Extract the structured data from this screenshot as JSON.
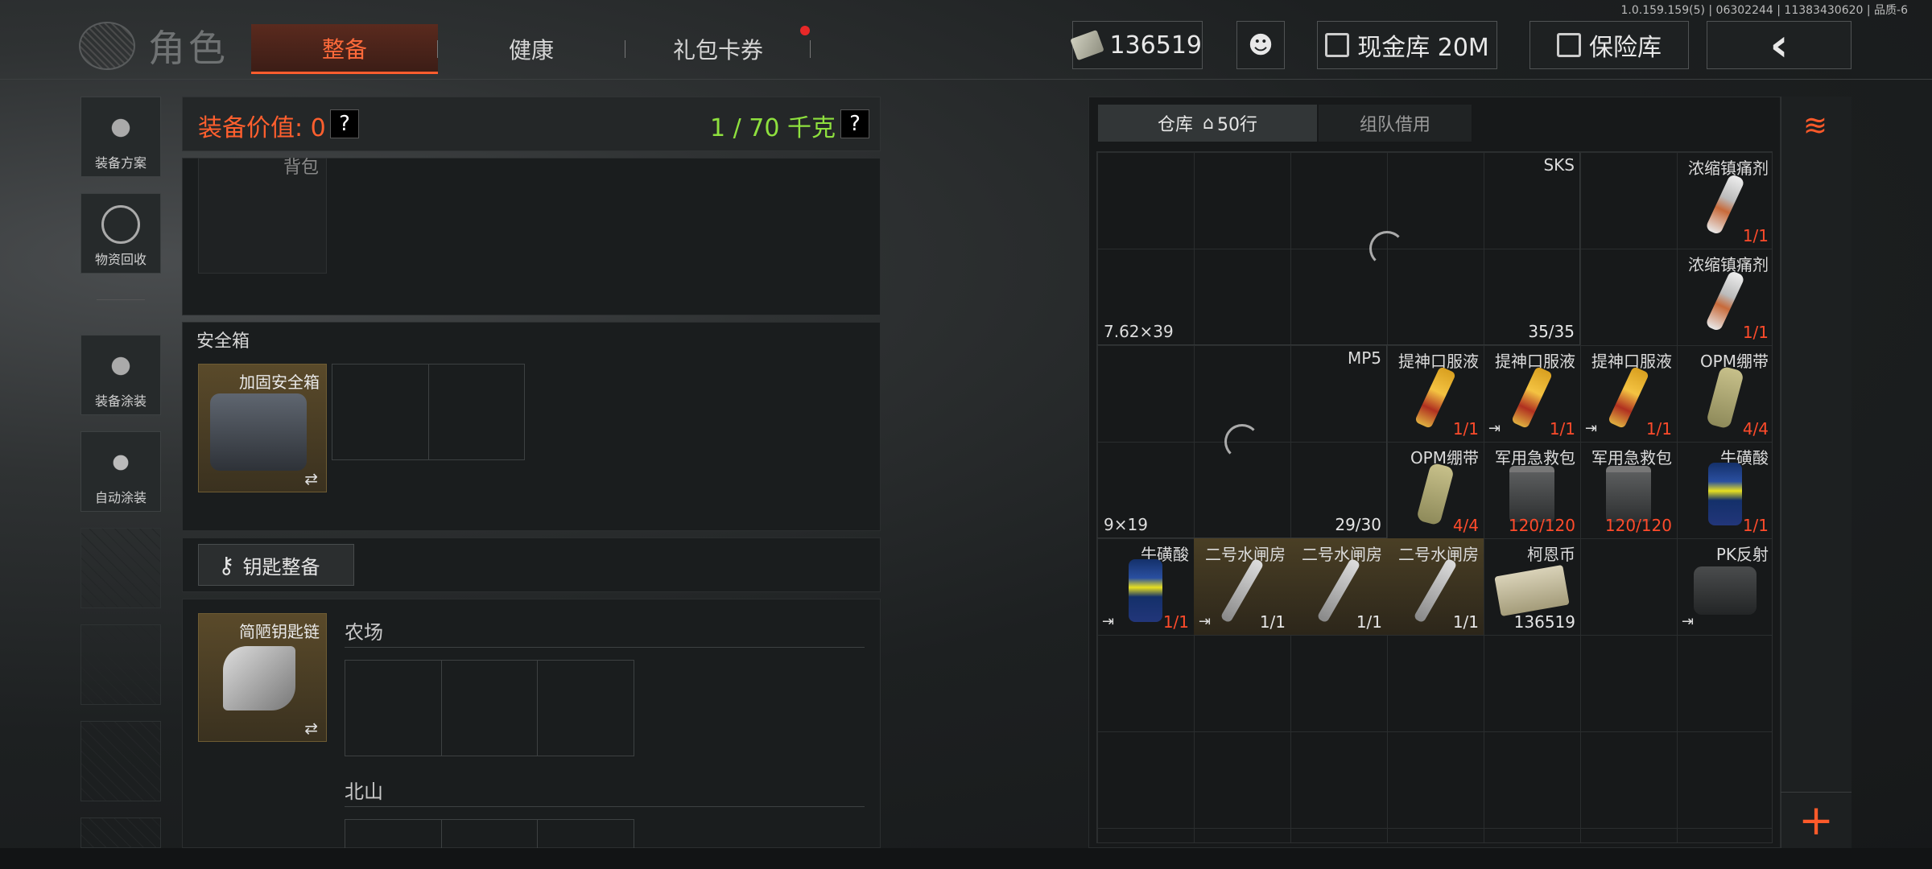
{
  "version": "1.0.159.159(5) | 06302244 | 11383430620 | 品质-6",
  "header": {
    "logo_title": "角色",
    "tabs": [
      {
        "label": "整备"
      },
      {
        "label": "健康"
      },
      {
        "label": "礼包卡券"
      }
    ],
    "money": "136519",
    "cash_vault": "现金库 20M",
    "safe_vault": "保险库",
    "back": "‹"
  },
  "sidebar": {
    "items": [
      {
        "label": "装备方案",
        "icon": "helmet-icon"
      },
      {
        "label": "物资回收",
        "icon": "recycle-icon"
      },
      {
        "label": "装备涂装",
        "icon": "paint-icon"
      },
      {
        "label": "自动涂装",
        "icon": "brush-gear-icon"
      }
    ]
  },
  "equipment": {
    "value_label": "装备价值: 0",
    "weight_label": "1 / 70 千克",
    "help": "?",
    "bag_label": "背包",
    "safe_box_title": "安全箱",
    "safe_box_item": "加固安全箱",
    "key_button": "钥匙整备",
    "key_item": "简陋钥匙链",
    "zones": [
      "农场",
      "北山"
    ],
    "swap_symbol": "⇄"
  },
  "warehouse": {
    "tabs": [
      {
        "label": "仓库",
        "extra": "50行"
      },
      {
        "label": "组队借用"
      }
    ],
    "weapons": [
      {
        "name": "SKS",
        "ammo": "7.62×39",
        "count": "35/35"
      },
      {
        "name": "MP5",
        "ammo": "9×19",
        "count": "29/30"
      }
    ],
    "items": [
      {
        "name": "浓缩镇痛剂",
        "count": "1/1",
        "kind": "syringe"
      },
      {
        "name": "浓缩镇痛剂",
        "count": "1/1",
        "kind": "syringe"
      },
      {
        "name": "提神口服液",
        "count": "1/1",
        "kind": "tube"
      },
      {
        "name": "提神口服液",
        "count": "1/1",
        "kind": "tube"
      },
      {
        "name": "提神口服液",
        "count": "1/1",
        "kind": "tube"
      },
      {
        "name": "OPM绷带",
        "count": "4/4",
        "kind": "bandage"
      },
      {
        "name": "OPM绷带",
        "count": "4/4",
        "kind": "bandage"
      },
      {
        "name": "军用急救包",
        "count": "120/120",
        "kind": "medkit"
      },
      {
        "name": "军用急救包",
        "count": "120/120",
        "kind": "medkit"
      },
      {
        "name": "牛磺酸",
        "count": "1/1",
        "kind": "can"
      },
      {
        "name": "牛磺酸",
        "count": "1/1",
        "kind": "can"
      },
      {
        "name": "二号水闸房",
        "count": "1/1",
        "kind": "key"
      },
      {
        "name": "二号水闸房",
        "count": "1/1",
        "kind": "key"
      },
      {
        "name": "二号水闸房",
        "count": "1/1",
        "kind": "key"
      },
      {
        "name": "柯恩币",
        "count": "136519",
        "kind": "cash"
      },
      {
        "name": "PK反射",
        "count": "",
        "kind": "sight"
      }
    ],
    "plus": "+"
  },
  "colors": {
    "accent": "#ff5d2e",
    "weight_green": "#8ee03e",
    "count_red": "#ff4b2b"
  }
}
